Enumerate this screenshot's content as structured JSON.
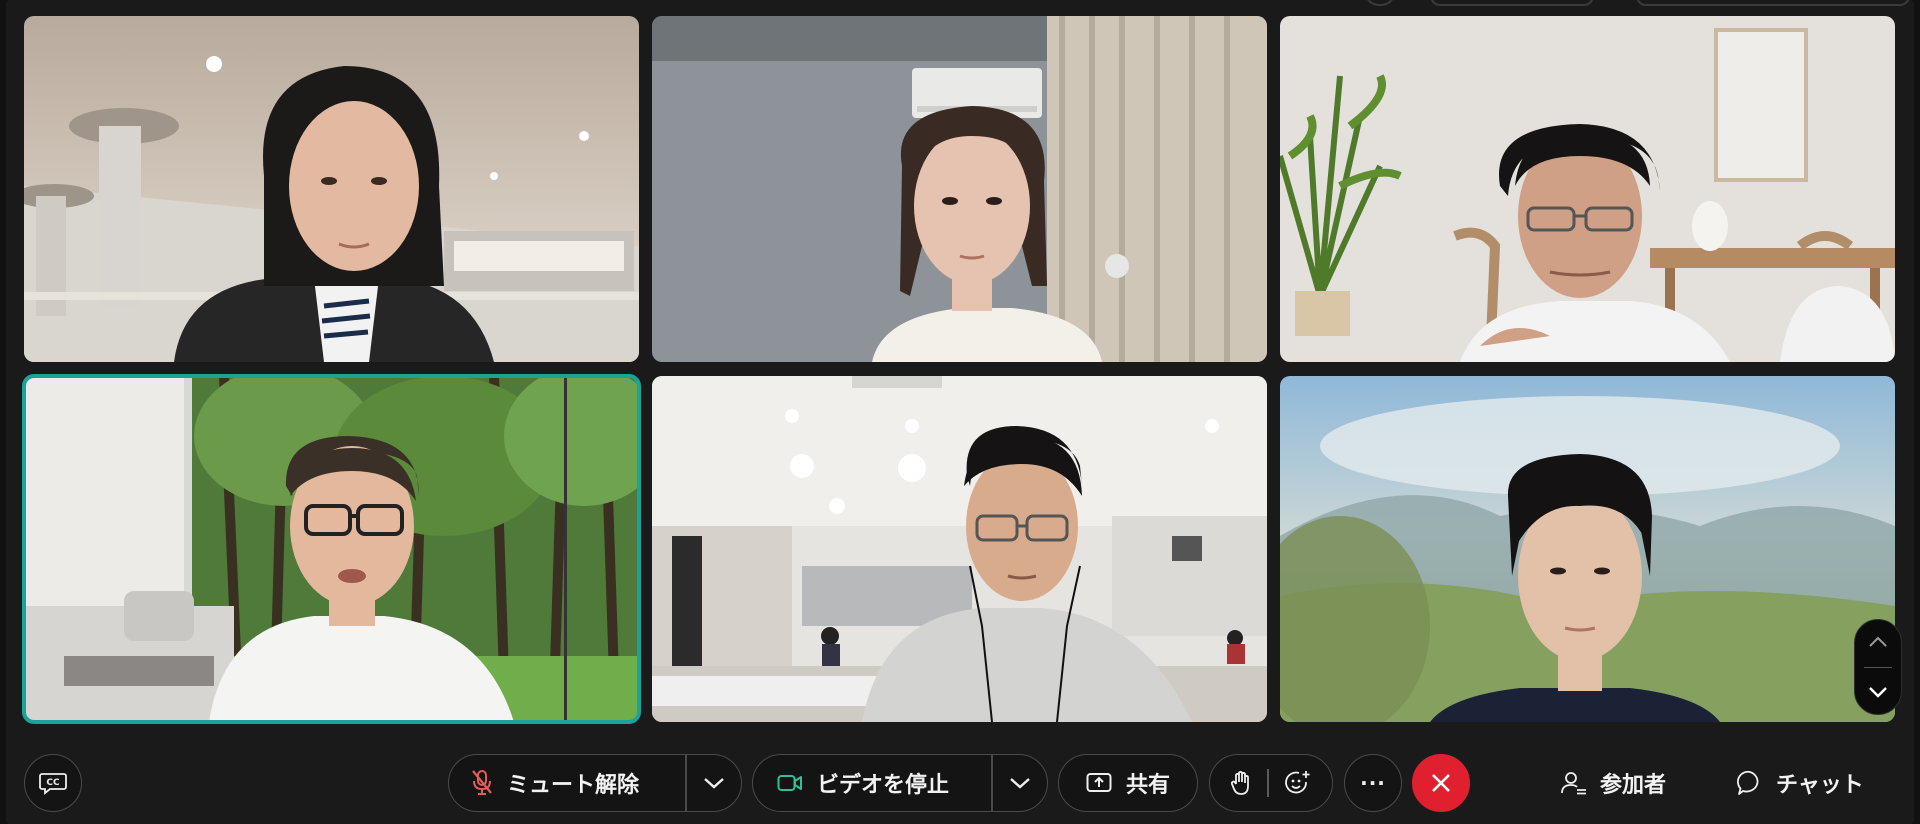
{
  "colors": {
    "background": "#1a1a1a",
    "active_border": "#1aa39a",
    "end_call": "#e0202e",
    "mute_icon": "#e65a5a",
    "video_icon": "#2fbf9a"
  },
  "participants": [
    {
      "id": "p1",
      "background": "atrium"
    },
    {
      "id": "p2",
      "background": "room"
    },
    {
      "id": "p3",
      "background": "dining"
    },
    {
      "id": "p4",
      "background": "forest",
      "active_speaker": true
    },
    {
      "id": "p5",
      "background": "office"
    },
    {
      "id": "p6",
      "background": "blur-mountain"
    }
  ],
  "toolbar": {
    "captions_icon": "cc-icon",
    "unmute_label": "ミュート解除",
    "stop_video_label": "ビデオを停止",
    "share_label": "共有",
    "raise_hand_icon": "hand-icon",
    "reactions_icon": "emoji-add-icon",
    "more_label": "···",
    "end_icon": "close-icon",
    "participants_label": "参加者",
    "chat_label": "チャット"
  }
}
